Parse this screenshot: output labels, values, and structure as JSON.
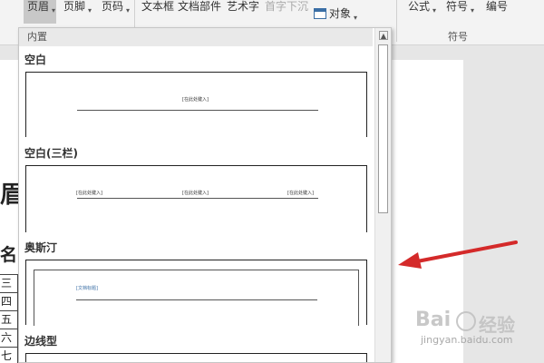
{
  "ribbon": {
    "header": "页眉",
    "footer": "页脚",
    "page_number": "页码",
    "text_box": "文本框",
    "quick_parts": "文档部件",
    "wordart": "艺术字",
    "drop_cap": "首字下沉",
    "object": "对象",
    "equation": "公式",
    "symbol": "符号",
    "numbering": "编号",
    "group_symbols": "符号"
  },
  "gallery": {
    "section": "内置",
    "items": [
      {
        "label": "空白",
        "placeholders": [
          "[在此处键入]"
        ]
      },
      {
        "label": "空白(三栏)",
        "placeholders": [
          "[在此处键入]",
          "[在此处键入]",
          "[在此处键入]"
        ]
      },
      {
        "label": "奥斯汀",
        "placeholders": [
          "[文档标题]"
        ]
      },
      {
        "label": "边线型",
        "placeholders": []
      }
    ]
  },
  "document": {
    "title_fragment": "眉",
    "name_fragment": "名",
    "rows": [
      "三",
      "四",
      "五",
      "六",
      "七"
    ]
  },
  "watermark": {
    "logo": "Bai",
    "logo_cn": "经验",
    "url": "jingyan.baidu.com"
  },
  "colors": {
    "arrow": "#d42a2a",
    "ribbon_bg": "#f3f3f3",
    "accent_blue": "#3a6ea5"
  }
}
